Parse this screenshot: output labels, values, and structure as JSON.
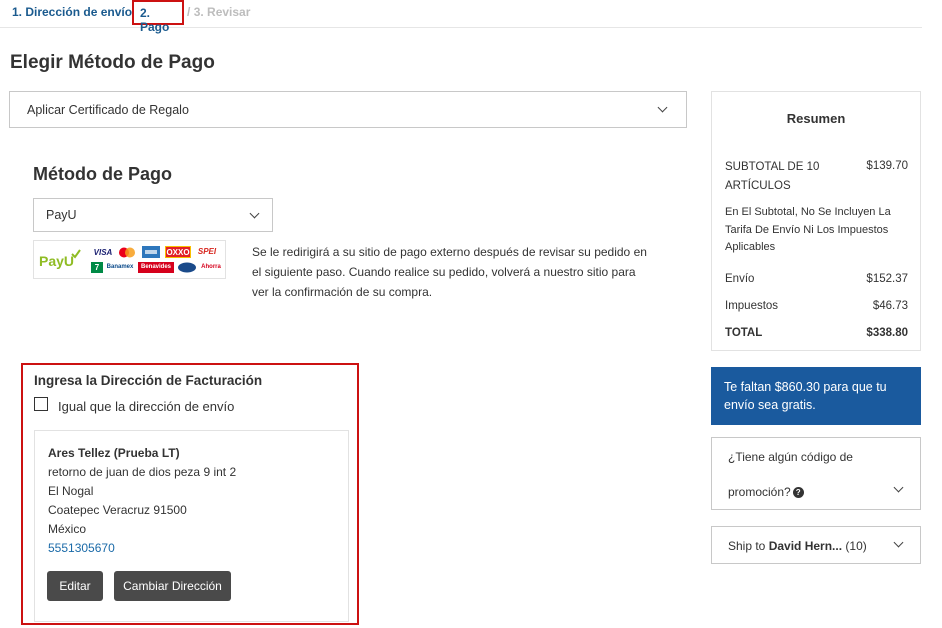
{
  "steps": {
    "step1": "1. Dirección de envío",
    "step2": "2. Pago",
    "sep": "/",
    "step3": "3. Revisar"
  },
  "page_title": "Elegir Método de Pago",
  "gift_certificate": {
    "label": "Aplicar Certificado de Regalo"
  },
  "payment_method": {
    "title": "Método de Pago",
    "selected": "PayU",
    "logo": {
      "brand": "PayU",
      "cards": [
        "VISA",
        "OXXO",
        "SPEI",
        "7",
        "Banamex",
        "Benavides",
        "Ahorra"
      ]
    },
    "description": "Se le redirigirá a su sitio de pago externo después de revisar su pedido en el siguiente paso. Cuando realice su pedido, volverá a nuestro sitio para ver la confirmación de su compra."
  },
  "billing": {
    "title": "Ingresa la Dirección de Facturación",
    "same_as_shipping": "Igual que la dirección de envío",
    "address": {
      "name": "Ares Tellez (Prueba LT)",
      "line1": "retorno de juan de dios peza 9 int 2",
      "line2": "El Nogal",
      "line3": "Coatepec Veracruz 91500",
      "country": "México",
      "phone": "5551305670"
    },
    "edit_button": "Editar",
    "change_button": "Cambiar Dirección"
  },
  "summary": {
    "title": "Resumen",
    "subtotal_label": "SUBTOTAL DE 10 ARTÍCULOS",
    "subtotal_value": "$139.70",
    "note": "En El Subtotal, No Se Incluyen La Tarifa De Envío Ni Los Impuestos Aplicables",
    "shipping_label": "Envío",
    "shipping_value": "$152.37",
    "taxes_label": "Impuestos",
    "taxes_value": "$46.73",
    "total_label": "TOTAL",
    "total_value": "$338.80"
  },
  "free_shipping": "Te faltan $860.30 para que tu envío sea gratis.",
  "promo": {
    "line1": "¿Tiene algún código de",
    "line2": "promoción?"
  },
  "ship_to": {
    "prefix": "Ship to",
    "name": "David Hern...",
    "count": "(10)"
  },
  "colors": {
    "link_blue": "#1a5a8e",
    "highlight_red": "#cc1111",
    "banner_blue": "#1a5a9e",
    "button_gray": "#4a4a4a",
    "payu_green": "#8fbc24"
  },
  "icons": [
    "chevron-down-icon",
    "question-icon",
    "checkbox"
  ]
}
